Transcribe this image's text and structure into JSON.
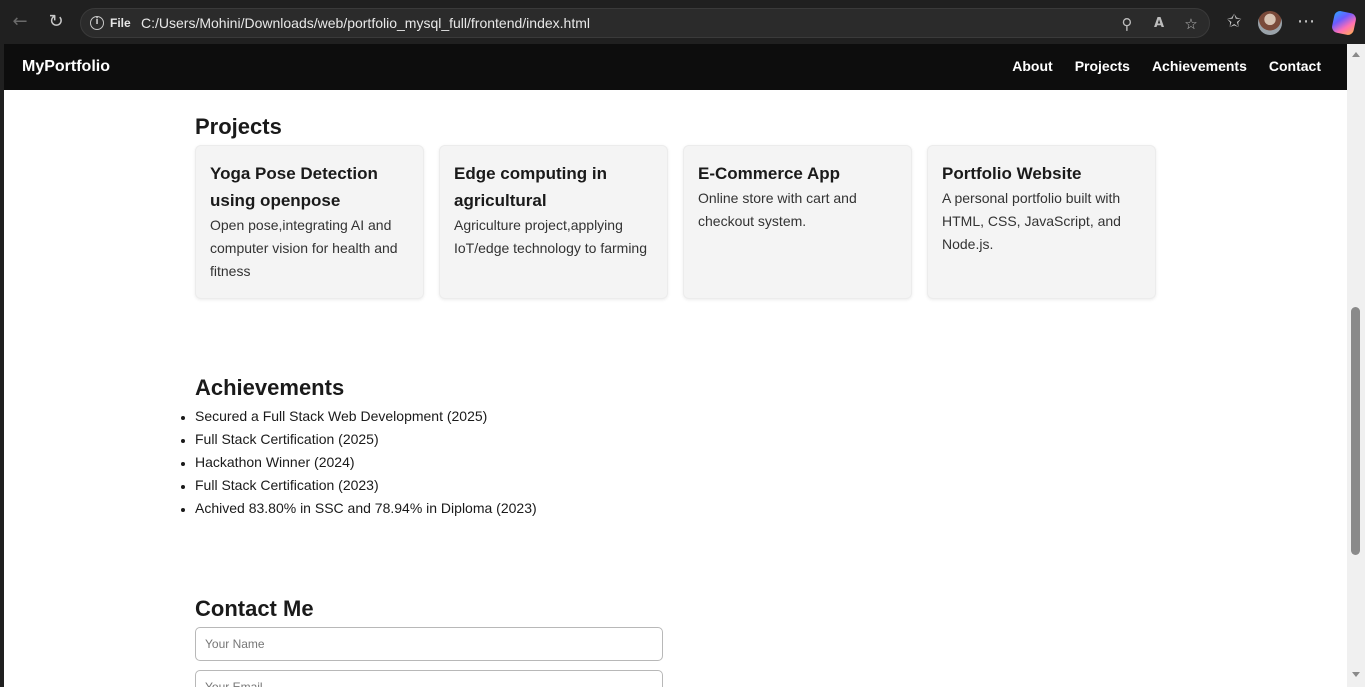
{
  "browser": {
    "back_icon": "←",
    "reload_icon": "↻",
    "info_icon": "i",
    "file_label": "File",
    "url": "C:/Users/Mohini/Downloads/web/portfolio_mysql_full/frontend/index.html",
    "zoom_icon": "⚲",
    "read_aloud_icon": "A",
    "favorite_icon": "☆",
    "favorites_icon": "✩",
    "more_icon": "⋯"
  },
  "nav": {
    "brand": "MyPortfolio",
    "links": [
      "About",
      "Projects",
      "Achievements",
      "Contact"
    ]
  },
  "projects": {
    "title": "Projects",
    "items": [
      {
        "title": "Yoga Pose Detection using openpose",
        "desc": "Open pose,integrating AI and computer vision for health and fitness"
      },
      {
        "title": "Edge computing in agricultural",
        "desc": "Agriculture project,applying IoT/edge technology to farming"
      },
      {
        "title": "E-Commerce App",
        "desc": "Online store with cart and checkout system."
      },
      {
        "title": "Portfolio Website",
        "desc": "A personal portfolio built with HTML, CSS, JavaScript, and Node.js."
      }
    ]
  },
  "achievements": {
    "title": "Achievements",
    "items": [
      "Secured a Full Stack Web Development (2025)",
      "Full Stack Certification (2025)",
      "Hackathon Winner (2024)",
      "Full Stack Certification (2023)",
      "Achived 83.80% in SSC and 78.94% in Diploma (2023)"
    ]
  },
  "contact": {
    "title": "Contact Me",
    "name_placeholder": "Your Name",
    "email_placeholder": "Your Email"
  }
}
